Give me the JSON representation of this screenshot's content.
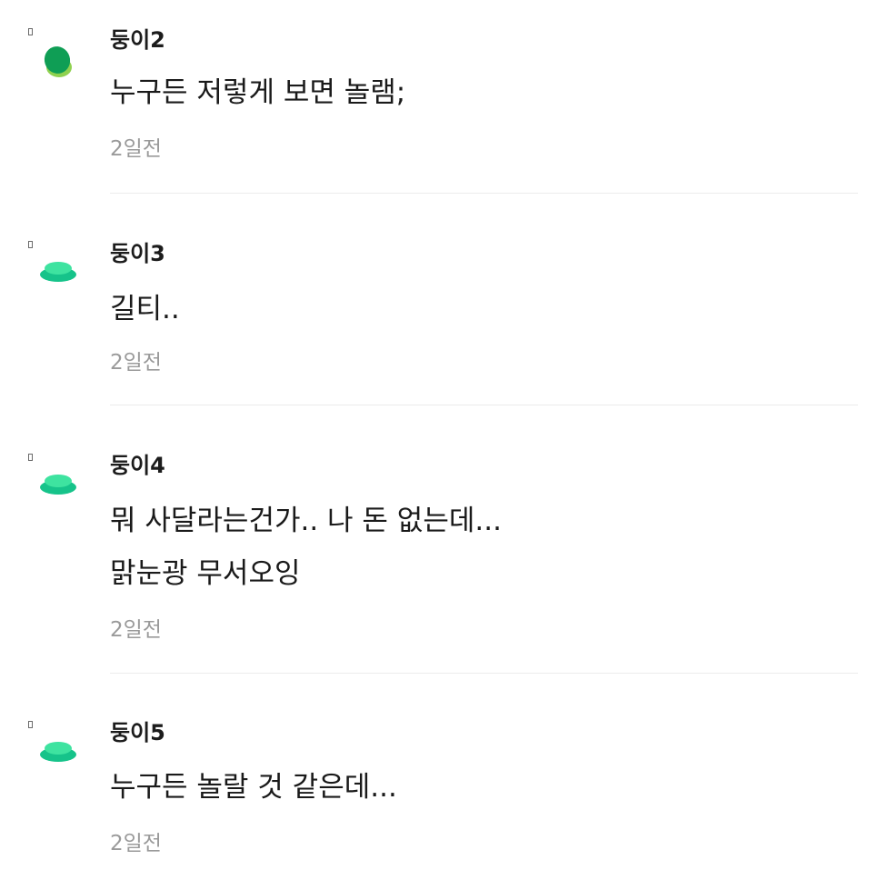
{
  "comments": [
    {
      "author": "둥이2",
      "lines": [
        "누구든 저렇게 보면 놀램;"
      ],
      "time": "2일전",
      "avatar_icon": "green-blob-icon",
      "avatar_colors": [
        "#0f9e55",
        "#8fd14f"
      ]
    },
    {
      "author": "둥이3",
      "lines": [
        "길티.."
      ],
      "time": "2일전",
      "avatar_icon": "mint-layers-icon",
      "avatar_colors": [
        "#3ee3a0",
        "#16c38a"
      ]
    },
    {
      "author": "둥이4",
      "lines": [
        "뭐 사달라는건가.. 나 돈 없는데...",
        "맑눈광 무서오잉"
      ],
      "time": "2일전",
      "avatar_icon": "mint-layers-icon",
      "avatar_colors": [
        "#3ee3a0",
        "#16c38a"
      ]
    },
    {
      "author": "둥이5",
      "lines": [
        "누구든 놀랄 것 같은데..."
      ],
      "time": "2일전",
      "avatar_icon": "mint-layers-icon",
      "avatar_colors": [
        "#3ee3a0",
        "#16c38a"
      ]
    }
  ]
}
